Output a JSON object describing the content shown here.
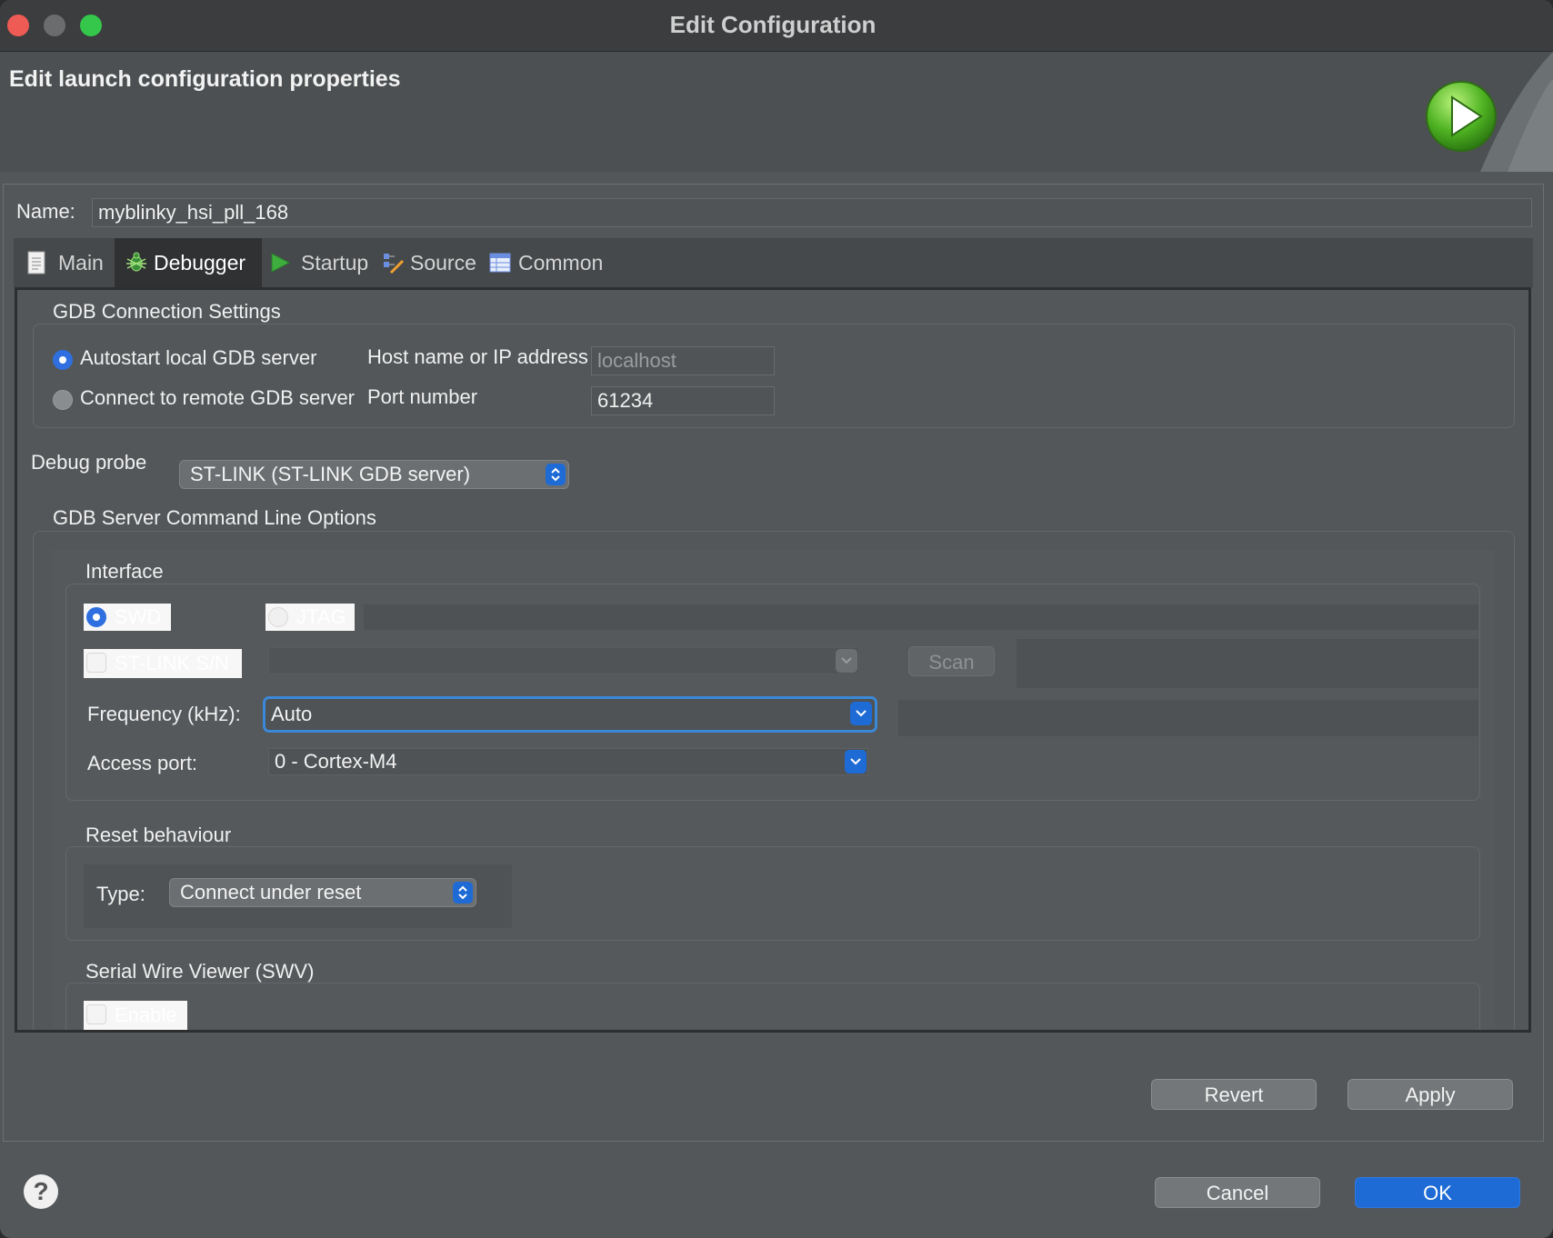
{
  "window": {
    "title": "Edit Configuration"
  },
  "header": {
    "title": "Edit launch configuration properties"
  },
  "name_field": {
    "label": "Name:",
    "value": "myblinky_hsi_pll_168"
  },
  "tabs": [
    {
      "label": "Main",
      "icon": "document-icon"
    },
    {
      "label": "Debugger",
      "icon": "bug-icon"
    },
    {
      "label": "Startup",
      "icon": "play-icon"
    },
    {
      "label": "Source",
      "icon": "source-icon"
    },
    {
      "label": "Common",
      "icon": "table-icon"
    }
  ],
  "gdb_connection": {
    "title": "GDB Connection Settings",
    "autostart_label": "Autostart local GDB server",
    "remote_label": "Connect to remote GDB server",
    "host_label": "Host name or IP address",
    "host_value": "localhost",
    "port_label": "Port number",
    "port_value": "61234"
  },
  "debug_probe": {
    "label": "Debug probe",
    "value": "ST-LINK (ST-LINK GDB server)"
  },
  "server_options": {
    "title": "GDB Server Command Line Options",
    "interface": {
      "title": "Interface",
      "swd_label": "SWD",
      "jtag_label": "JTAG",
      "stlink_sn_label": "ST-LINK S/N",
      "scan_label": "Scan",
      "frequency_label": "Frequency (kHz):",
      "frequency_value": "Auto",
      "access_port_label": "Access port:",
      "access_port_value": "0 - Cortex-M4"
    },
    "reset": {
      "title": "Reset behaviour",
      "type_label": "Type:",
      "type_value": "Connect under reset"
    },
    "swv": {
      "title": "Serial Wire Viewer (SWV)",
      "enable_label": "Enable"
    }
  },
  "buttons": {
    "revert": "Revert",
    "apply": "Apply",
    "cancel": "Cancel",
    "ok": "OK",
    "help": "?"
  },
  "colors": {
    "accent": "#1f6bd6",
    "background": "#535759"
  }
}
